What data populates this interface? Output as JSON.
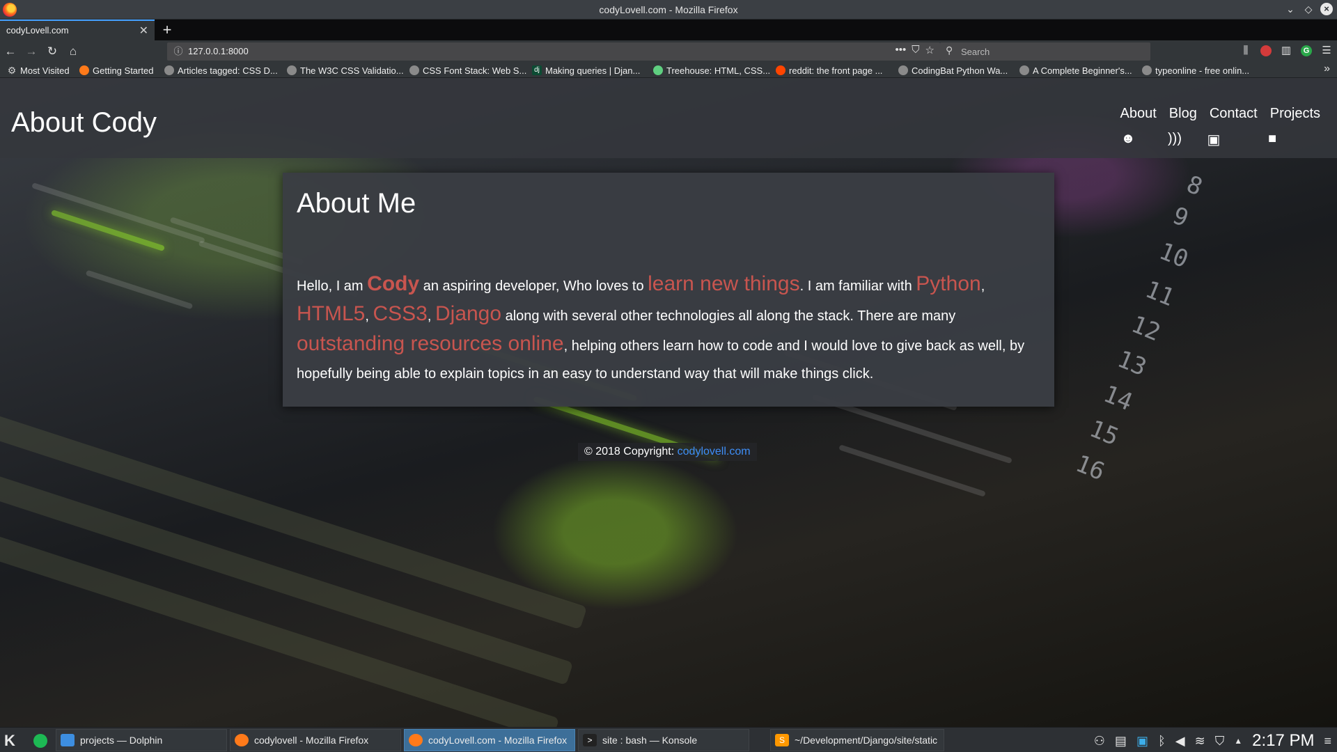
{
  "window": {
    "title": "codyLovell.com - Mozilla Firefox"
  },
  "tab": {
    "title": "codyLovell.com",
    "close": "✕"
  },
  "newtab": "+",
  "navbar": {
    "url": "127.0.0.1:8000",
    "search_placeholder": "Search",
    "more_glyph": "•••"
  },
  "bookmarks": [
    {
      "label": "Most Visited",
      "icon": "gear-icon",
      "color": "#9a9a9a"
    },
    {
      "label": "Getting Started",
      "icon": "firefox-icon",
      "color": "#ff7a1a"
    },
    {
      "label": "Articles tagged: CSS D...",
      "icon": "globe-icon",
      "color": "#8a8a8a"
    },
    {
      "label": "The W3C CSS Validatio...",
      "icon": "globe-icon",
      "color": "#8a8a8a"
    },
    {
      "label": "CSS Font Stack: Web S...",
      "icon": "globe-icon",
      "color": "#8a8a8a"
    },
    {
      "label": "Making queries | Djan...",
      "icon": "django-icon",
      "color": "#0c4b33"
    },
    {
      "label": "Treehouse: HTML, CSS...",
      "icon": "treehouse-icon",
      "color": "#5fcf80"
    },
    {
      "label": "reddit: the front page ...",
      "icon": "reddit-icon",
      "color": "#ff4500"
    },
    {
      "label": "CodingBat Python Wa...",
      "icon": "globe-icon",
      "color": "#8a8a8a"
    },
    {
      "label": "A Complete Beginner's...",
      "icon": "globe-icon",
      "color": "#8a8a8a"
    },
    {
      "label": "typeonline - free onlin...",
      "icon": "globe-icon",
      "color": "#8a8a8a"
    }
  ],
  "site": {
    "brand": "About Cody",
    "nav": [
      "About",
      "Blog",
      "Contact",
      "Projects"
    ],
    "nav_icons": [
      "smiley-icon",
      "rss-icon",
      "contact-card-icon",
      "briefcase-icon"
    ]
  },
  "about": {
    "heading": "About Me",
    "p1": "Hello, I am ",
    "name": "Cody",
    "p2": " an aspiring developer, Who loves to ",
    "learn": "learn new things",
    "p3": ". I am familiar with ",
    "python": "Python",
    "comma1": ",",
    "html5": "HTML5",
    "comma2": ",",
    "css3": "CSS3",
    "comma3": ",",
    "django": "Django",
    "p4": " along with several other technologies all along the stack. There are many ",
    "resources": "outstanding resources online",
    "p5": ", helping others learn how to code and I would love to give back as well, by hopefully being able to explain topics in an easy to understand way that will make things click.",
    "accent_color": "#c8554f"
  },
  "footer": {
    "text": "© 2018 Copyright: ",
    "link": "codylovell.com",
    "link_color": "#3e8ef7"
  },
  "taskbar": {
    "tasks": [
      {
        "label": "projects — Dolphin",
        "icon": "dolphin-icon"
      },
      {
        "label": "codylovell - Mozilla Firefox",
        "icon": "firefox-icon"
      },
      {
        "label": "codyLovell.com - Mozilla Firefox",
        "icon": "firefox-icon",
        "active": true
      },
      {
        "label": "site : bash — Konsole",
        "icon": "konsole-icon"
      },
      {
        "label": "~/Development/Django/site/static",
        "icon": "sublime-icon"
      }
    ],
    "clock": "2:17 PM"
  }
}
